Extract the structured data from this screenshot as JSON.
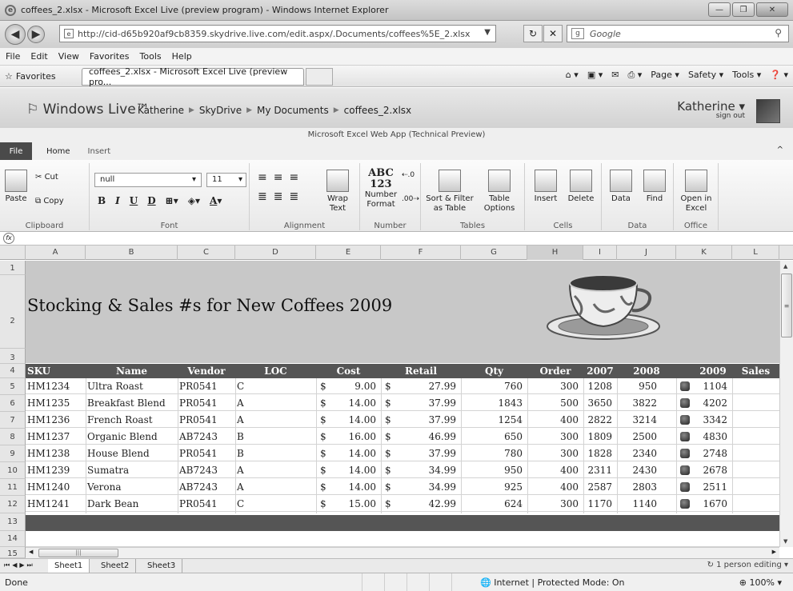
{
  "window": {
    "title": "coffees_2.xlsx - Microsoft Excel Live (preview program) - Windows Internet Explorer",
    "url": "http://cid-d65b920af9cb8359.skydrive.live.com/edit.aspx/.Documents/coffees%5E_2.xlsx",
    "search_placeholder": "Google",
    "menu": [
      "File",
      "Edit",
      "View",
      "Favorites",
      "Tools",
      "Help"
    ],
    "favorites_label": "Favorites",
    "tab_title": "coffees_2.xlsx - Microsoft Excel Live (preview pro...",
    "commands": [
      "Page ▾",
      "Safety ▾",
      "Tools ▾"
    ]
  },
  "live": {
    "brand": "Windows Live™",
    "breadcrumb": [
      "Katherine",
      "SkyDrive",
      "My Documents",
      "coffees_2.xlsx"
    ],
    "user": "Katherine ▾",
    "signout": "sign out",
    "app_title": "Microsoft Excel Web App (Technical Preview)"
  },
  "ribbon": {
    "tabs": [
      "File",
      "Home",
      "Insert"
    ],
    "paste": "Paste",
    "cut": "Cut",
    "copy": "Copy",
    "font_name": "null",
    "font_size": "11",
    "wrap": "Wrap Text",
    "number_format": "Number Format",
    "sort_filter": "Sort & Filter as Table",
    "table_options": "Table Options",
    "insert": "Insert",
    "delete": "Delete",
    "data": "Data",
    "find": "Find",
    "open_excel": "Open in Excel",
    "groups": [
      "Clipboard",
      "Font",
      "Alignment",
      "Number",
      "Tables",
      "Cells",
      "Data",
      "Office"
    ]
  },
  "grid": {
    "columns": [
      "A",
      "B",
      "C",
      "D",
      "E",
      "F",
      "G",
      "H",
      "I",
      "J",
      "K",
      "L"
    ],
    "rows": [
      "1",
      "2",
      "3",
      "4",
      "5",
      "6",
      "7",
      "8",
      "9",
      "10",
      "11",
      "12",
      "13",
      "14",
      "15"
    ],
    "sheet_title": "Stocking & Sales #s for New Coffees 2009",
    "headers": [
      "SKU",
      "Name",
      "Vendor",
      "LOC",
      "Cost",
      "Retail",
      "Qty",
      "Order",
      "2007",
      "2008",
      "2009",
      "Sales"
    ],
    "data": [
      {
        "sku": "HM1234",
        "name": "Ultra Roast",
        "vendor": "PR0541",
        "loc": "C",
        "cost": "9.00",
        "retail": "27.99",
        "qty": "760",
        "order": "300",
        "y2007": "1208",
        "y2008": "950",
        "y2009": "1104"
      },
      {
        "sku": "HM1235",
        "name": "Breakfast Blend",
        "vendor": "PR0541",
        "loc": "A",
        "cost": "14.00",
        "retail": "37.99",
        "qty": "1843",
        "order": "500",
        "y2007": "3650",
        "y2008": "3822",
        "y2009": "4202"
      },
      {
        "sku": "HM1236",
        "name": "French Roast",
        "vendor": "PR0541",
        "loc": "A",
        "cost": "14.00",
        "retail": "37.99",
        "qty": "1254",
        "order": "400",
        "y2007": "2822",
        "y2008": "3214",
        "y2009": "3342"
      },
      {
        "sku": "HM1237",
        "name": "Organic Blend",
        "vendor": "AB7243",
        "loc": "B",
        "cost": "16.00",
        "retail": "46.99",
        "qty": "650",
        "order": "300",
        "y2007": "1809",
        "y2008": "2500",
        "y2009": "4830"
      },
      {
        "sku": "HM1238",
        "name": "House Blend",
        "vendor": "PR0541",
        "loc": "B",
        "cost": "14.00",
        "retail": "37.99",
        "qty": "780",
        "order": "300",
        "y2007": "1828",
        "y2008": "2340",
        "y2009": "2748"
      },
      {
        "sku": "HM1239",
        "name": "Sumatra",
        "vendor": "AB7243",
        "loc": "A",
        "cost": "14.00",
        "retail": "34.99",
        "qty": "950",
        "order": "400",
        "y2007": "2311",
        "y2008": "2430",
        "y2009": "2678"
      },
      {
        "sku": "HM1240",
        "name": "Verona",
        "vendor": "AB7243",
        "loc": "A",
        "cost": "14.00",
        "retail": "34.99",
        "qty": "925",
        "order": "400",
        "y2007": "2587",
        "y2008": "2803",
        "y2009": "2511"
      },
      {
        "sku": "HM1241",
        "name": "Dark Bean",
        "vendor": "PR0541",
        "loc": "C",
        "cost": "15.00",
        "retail": "42.99",
        "qty": "624",
        "order": "300",
        "y2007": "1170",
        "y2008": "1140",
        "y2009": "1670"
      }
    ],
    "currency": "$",
    "sheets": [
      "Sheet1",
      "Sheet2",
      "Sheet3"
    ],
    "editing": "1 person editing"
  },
  "status": {
    "done": "Done",
    "zone": "Internet | Protected Mode: On",
    "zoom": "100%"
  }
}
